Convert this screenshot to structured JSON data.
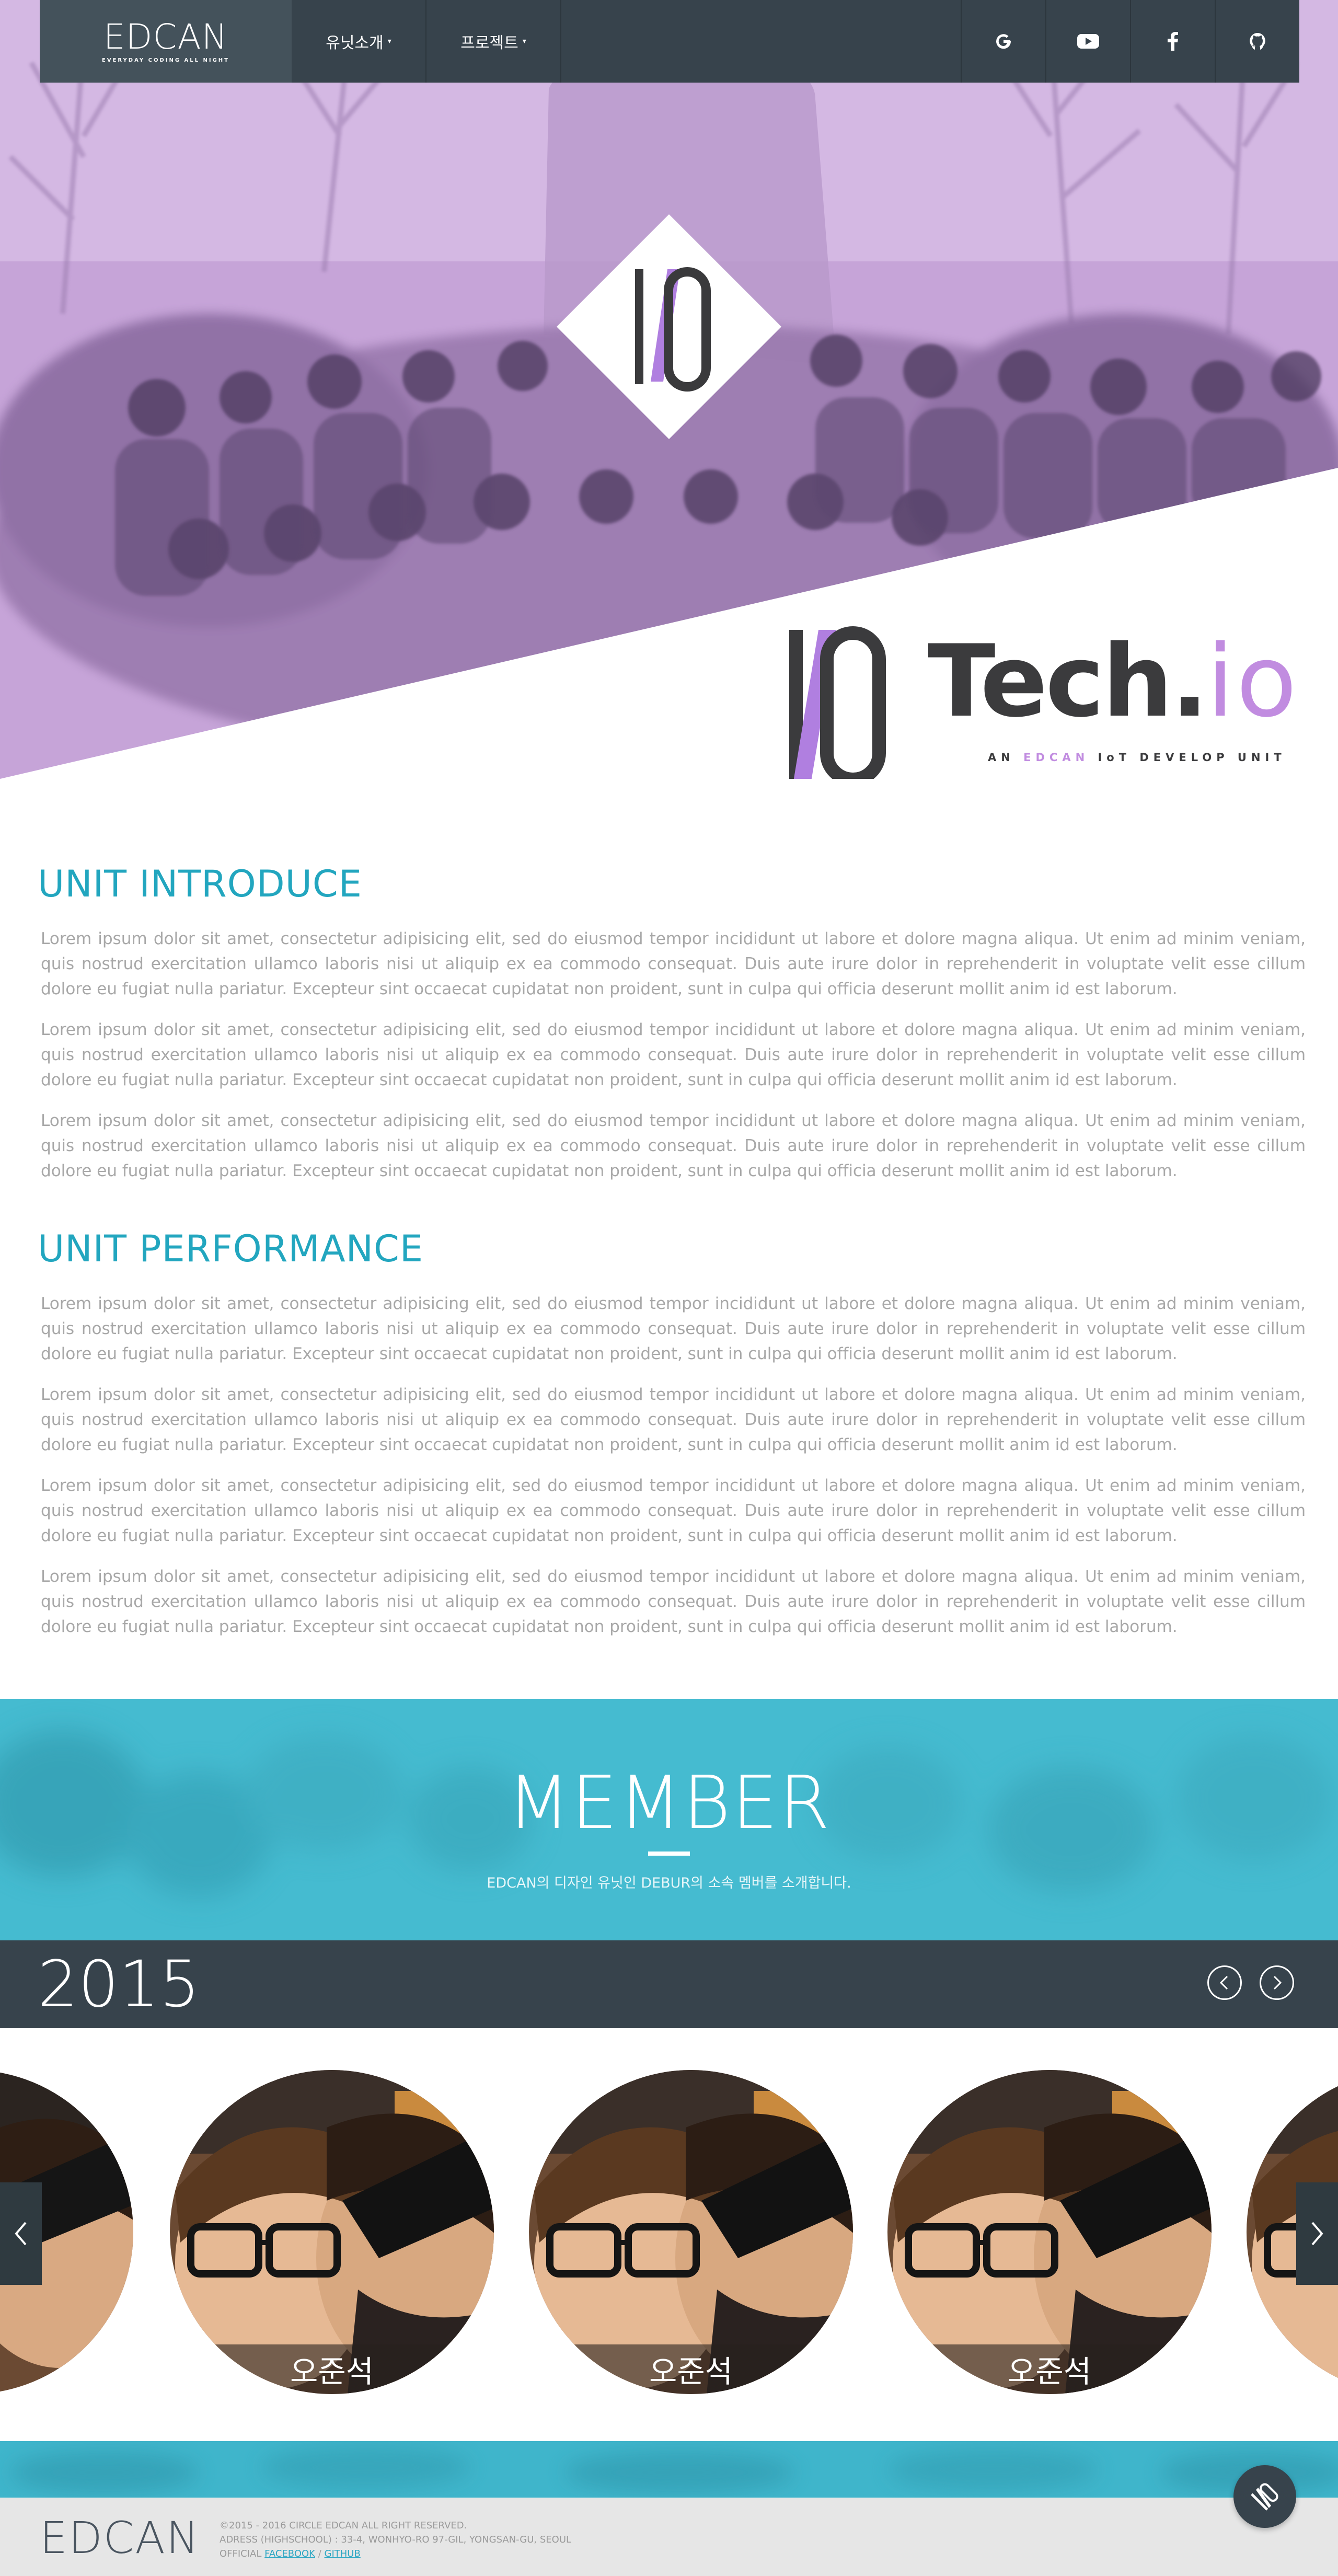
{
  "nav": {
    "logo": "EDCAN",
    "logo_tagline": "EVERYDAY CODING ALL NIGHT",
    "menu": [
      {
        "label": "유닛소개"
      },
      {
        "label": "프로젝트"
      }
    ],
    "social": [
      "google-icon",
      "youtube-icon",
      "facebook-icon",
      "github-icon"
    ]
  },
  "hero": {
    "brand_name": "Tech.",
    "brand_suffix": "io",
    "tagline_pre": "AN ",
    "tagline_hl": "EDCAN",
    "tagline_post": " IoT DEVELOP UNIT",
    "accent": "#c18ce0"
  },
  "intro": {
    "heading": "UNIT INTRODUCE",
    "paragraphs": [
      "Lorem ipsum dolor sit amet, consectetur adipisicing elit, sed do eiusmod tempor incididunt ut labore et dolore magna aliqua. Ut enim ad minim veniam, quis nostrud exercitation ullamco laboris nisi ut aliquip ex ea commodo consequat. Duis aute irure dolor in reprehenderit in voluptate velit esse cillum dolore eu fugiat nulla pariatur. Excepteur sint occaecat cupidatat non proident, sunt in culpa qui officia deserunt mollit anim id est laborum.",
      "Lorem ipsum dolor sit amet, consectetur adipisicing elit, sed do eiusmod tempor incididunt ut labore et dolore magna aliqua. Ut enim ad minim veniam, quis nostrud exercitation ullamco laboris nisi ut aliquip ex ea commodo consequat. Duis aute irure dolor in reprehenderit in voluptate velit esse cillum dolore eu fugiat nulla pariatur. Excepteur sint occaecat cupidatat non proident, sunt in culpa qui officia deserunt mollit anim id est laborum.",
      "Lorem ipsum dolor sit amet, consectetur adipisicing elit, sed do eiusmod tempor incididunt ut labore et dolore magna aliqua. Ut enim ad minim veniam, quis nostrud exercitation ullamco laboris nisi ut aliquip ex ea commodo consequat. Duis aute irure dolor in reprehenderit in voluptate velit esse cillum dolore eu fugiat nulla pariatur. Excepteur sint occaecat cupidatat non proident, sunt in culpa qui officia deserunt mollit anim id est laborum."
    ]
  },
  "performance": {
    "heading": "UNIT PERFORMANCE",
    "paragraphs": [
      "Lorem ipsum dolor sit amet, consectetur adipisicing elit, sed do eiusmod tempor incididunt ut labore et dolore magna aliqua. Ut enim ad minim veniam, quis nostrud exercitation ullamco laboris nisi ut aliquip ex ea commodo consequat. Duis aute irure dolor in reprehenderit in voluptate velit esse cillum dolore eu fugiat nulla pariatur. Excepteur sint occaecat cupidatat non proident, sunt in culpa qui officia deserunt mollit anim id est laborum.",
      "Lorem ipsum dolor sit amet, consectetur adipisicing elit, sed do eiusmod tempor incididunt ut labore et dolore magna aliqua. Ut enim ad minim veniam, quis nostrud exercitation ullamco laboris nisi ut aliquip ex ea commodo consequat. Duis aute irure dolor in reprehenderit in voluptate velit esse cillum dolore eu fugiat nulla pariatur. Excepteur sint occaecat cupidatat non proident, sunt in culpa qui officia deserunt mollit anim id est laborum.",
      "Lorem ipsum dolor sit amet, consectetur adipisicing elit, sed do eiusmod tempor incididunt ut labore et dolore magna aliqua. Ut enim ad minim veniam, quis nostrud exercitation ullamco laboris nisi ut aliquip ex ea commodo consequat. Duis aute irure dolor in reprehenderit in voluptate velit esse cillum dolore eu fugiat nulla pariatur. Excepteur sint occaecat cupidatat non proident, sunt in culpa qui officia deserunt mollit anim id est laborum.",
      "Lorem ipsum dolor sit amet, consectetur adipisicing elit, sed do eiusmod tempor incididunt ut labore et dolore magna aliqua. Ut enim ad minim veniam, quis nostrud exercitation ullamco laboris nisi ut aliquip ex ea commodo consequat. Duis aute irure dolor in reprehenderit in voluptate velit esse cillum dolore eu fugiat nulla pariatur. Excepteur sint occaecat cupidatat non proident, sunt in culpa qui officia deserunt mollit anim id est laborum."
    ]
  },
  "member": {
    "title": "MEMBER",
    "subtitle": "EDCAN의 디자인 유닛인 DEBUR의 소속 멤버를 소개합니다.",
    "year": "2015",
    "members": [
      {
        "name": "오준석"
      },
      {
        "name": "오준석"
      },
      {
        "name": "오준석"
      }
    ]
  },
  "footer": {
    "logo": "EDCAN",
    "copyright": "©2015 - 2016 CIRCLE EDCAN ALL RIGHT RESERVED.",
    "address": "ADRESS (HIGHSCHOOL) : 33-4, WONHYO-RO 97-GIL, YONGSAN-GU, SEOUL",
    "official_label": "OFFICIAL",
    "facebook": "FACEBOOK",
    "separator": "/",
    "github": "GITHUB"
  },
  "colors": {
    "nav_bg": "#37434c",
    "heading": "#22a6bf",
    "member_band": "#43b8cd",
    "hero_tint": "#c9a7dc"
  }
}
